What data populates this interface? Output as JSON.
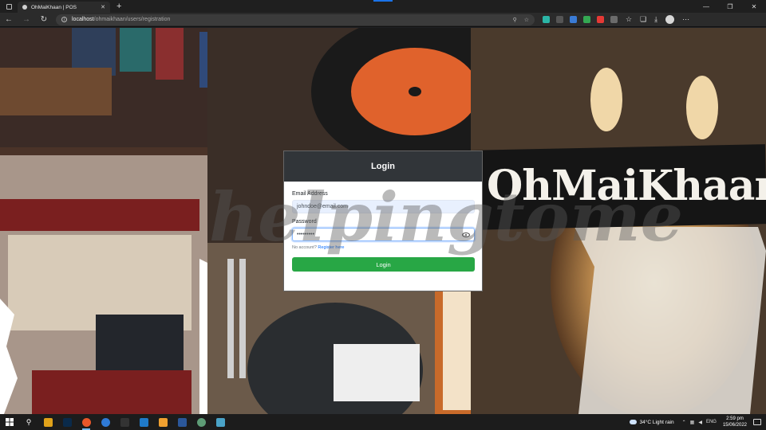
{
  "browser": {
    "tab_title": "OhMaiKhaan | POS",
    "url_host": "localhost",
    "url_path": "/ohmaikhaan/users/registration",
    "extension_colors": [
      "#2bb5a6",
      "#555555",
      "#3a7bd5",
      "#34a853",
      "#e53935",
      "#6b6b6b"
    ]
  },
  "page": {
    "brand": "OhMaiKhaan",
    "watermark": "helpingtome"
  },
  "login": {
    "title": "Login",
    "email_label": "Email Address",
    "email_value": "johndoe@email.com",
    "password_label": "Password",
    "password_mask": "•••••••••",
    "no_account_text": "No account?",
    "register_link": "Register here",
    "submit_label": "Login"
  },
  "taskbar": {
    "weather": "34°C  Light rain",
    "language": "ENG",
    "time": "2:59 pm",
    "date": "15/06/2022",
    "app_colors": [
      "#e0a21a",
      "#0a2a4a",
      "#e8572a",
      "#2f7ad6",
      "#333333",
      "#1f7ac9",
      "#f0a030",
      "#2b579a",
      "#5e9c76",
      "#4aa3c8"
    ]
  }
}
